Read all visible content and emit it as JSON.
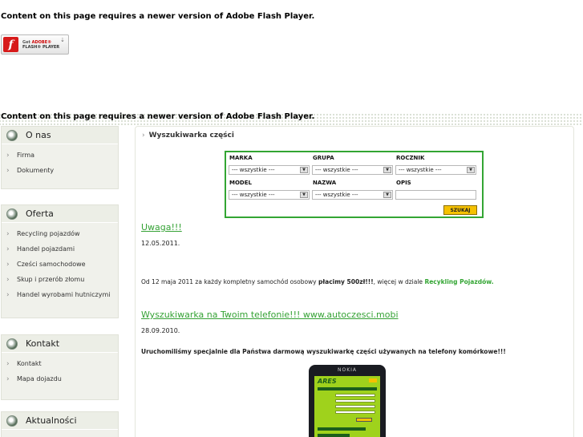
{
  "flash": {
    "message": "Content on this page requires a newer version of Adobe Flash Player.",
    "button_logo": "f",
    "button_line1_prefix": "Get ",
    "button_line1_brand": "ADOBE®",
    "button_line2": "FLASH® PLAYER",
    "button_arrow": "⇣"
  },
  "sidebar": {
    "onas": {
      "title": "O nas",
      "items": [
        {
          "label": "Firma"
        },
        {
          "label": "Dokumenty"
        }
      ]
    },
    "oferta": {
      "title": "Oferta",
      "items": [
        {
          "label": "Recycling pojazdów"
        },
        {
          "label": "Handel pojazdami"
        },
        {
          "label": "Cześci samochodowe"
        },
        {
          "label": "Skup i przerób złomu"
        },
        {
          "label": "Handel wyrobami hutniczymi"
        }
      ]
    },
    "kontakt": {
      "title": "Kontakt",
      "items": [
        {
          "label": "Kontakt"
        },
        {
          "label": "Mapa dojazdu"
        }
      ]
    },
    "aktualnosci": {
      "title": "Aktualności"
    }
  },
  "search": {
    "title": "Wyszukiwarka części",
    "labels": {
      "marka": "MARKA",
      "grupa": "GRUPA",
      "rocznik": "ROCZNIK",
      "model": "MODEL",
      "nazwa": "NAZWA",
      "opis": "OPIS"
    },
    "selects": {
      "marka": "--- wszystkie ---",
      "grupa": "--- wszystkie ---",
      "rocznik": "--- wszystkie ---",
      "model": "--- wszystkie ---",
      "nazwa": "--- wszystkie ---"
    },
    "opis_value": "",
    "submit_label": "SZUKAJ",
    "dropdown_arrow": "▼"
  },
  "news": [
    {
      "title": "Uwaga!!!",
      "date": "12.05.2011.",
      "body_prefix": "Od 12 maja  2011 za każdy kompletny samochód osobowy ",
      "body_bold": " płacimy 500zł!!!",
      "body_middle": ", więcej w dziale ",
      "body_link": "Recykling Pojazdów."
    },
    {
      "title": "Wyszukiwarka na Twoim telefonie!!! www.autoczesci.mobi",
      "date": "28.09.2010.",
      "body": "Uruchomiliśmy specjalnie dla Państwa darmową wyszukiwarkę części używanych na telefony komórkowe!!!"
    }
  ],
  "phone": {
    "brand": "NOKIA",
    "screen_logo": "ARES"
  },
  "icons": {
    "chevron": "›",
    "accent": "#33a533",
    "button": "#f5c100"
  }
}
